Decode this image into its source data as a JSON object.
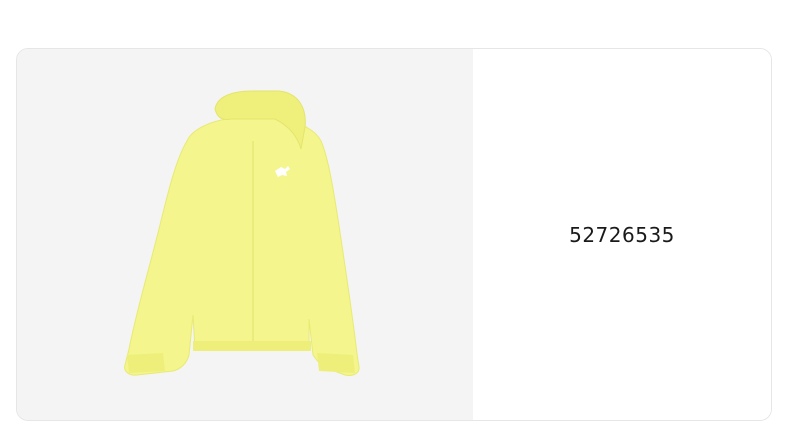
{
  "product": {
    "id_text": "52726535",
    "image_subject": "hooded-jacket",
    "image_color": "#f4f58c",
    "image_background": "#f4f4f4"
  }
}
